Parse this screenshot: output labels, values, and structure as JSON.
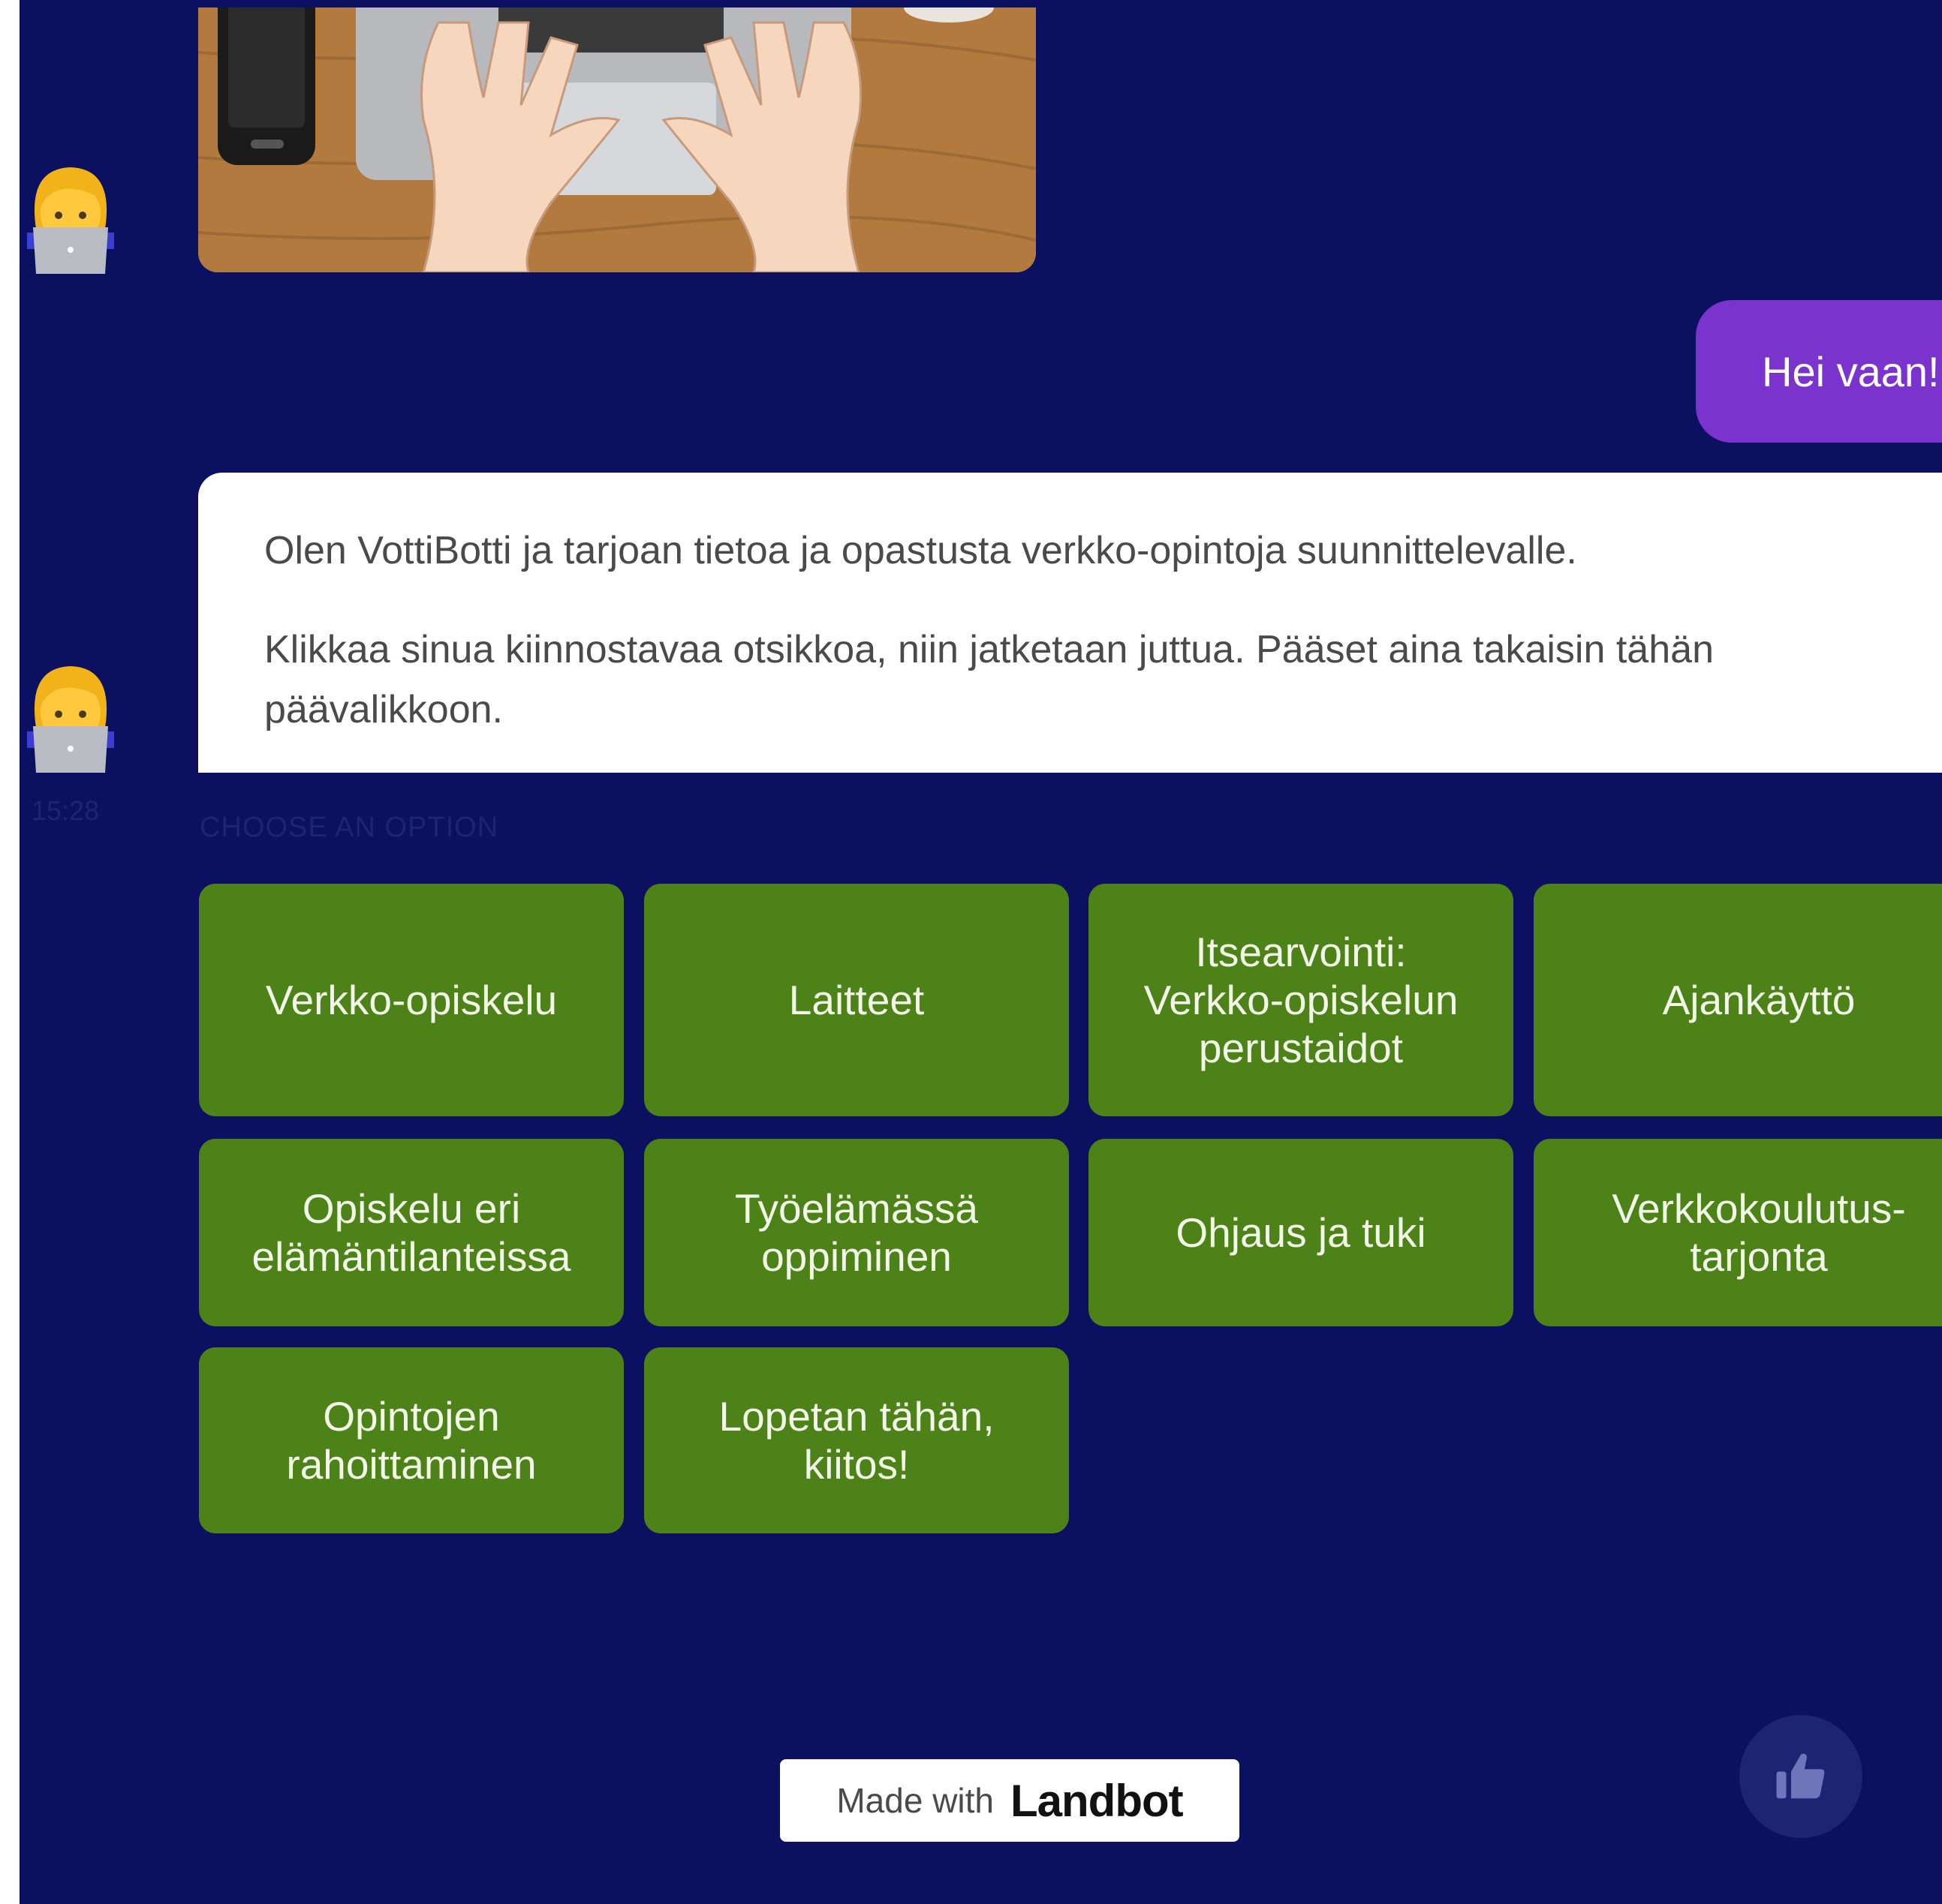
{
  "chat": {
    "user_message": "Hei vaan!",
    "bot_message": {
      "paragraph_1": "Olen VottiBotti ja tarjoan tietoa ja opastusta verkko-opintoja suunnittelevalle.",
      "paragraph_2": "Klikkaa sinua kiinnostavaa otsikkoa, niin jatketaan juttua. Pääset aina takaisin tähän päävalikkoon."
    },
    "timestamp": "15:28",
    "choose_label": "CHOOSE AN OPTION"
  },
  "options": [
    {
      "label": "Verkko-opiskelu"
    },
    {
      "label": "Laitteet"
    },
    {
      "label": "Itsearvointi:\nVerkko-opiskelun\nperustaidot"
    },
    {
      "label": "Ajankäyttö"
    },
    {
      "label": "Opiskelu eri\nelämäntilanteissa"
    },
    {
      "label": "Työelämässä\noppiminen"
    },
    {
      "label": "Ohjaus ja tuki"
    },
    {
      "label": "Verkkokoulutus-\ntarjonta"
    },
    {
      "label": "Opintojen\nrahoittaminen"
    },
    {
      "label": "Lopetan tähän,\nkiitos!"
    }
  ],
  "footer": {
    "made_with_text": "Made with",
    "brand": "Landbot"
  },
  "icons": {
    "avatar": "woman-technologist-emoji",
    "like": "thumbs-up-icon",
    "image": "hands-typing-on-laptop-illustration"
  },
  "colors": {
    "background": "#0b1160",
    "user_bubble": "#7a33cc",
    "option_button": "#4d8219",
    "bot_bubble": "#ffffff"
  }
}
